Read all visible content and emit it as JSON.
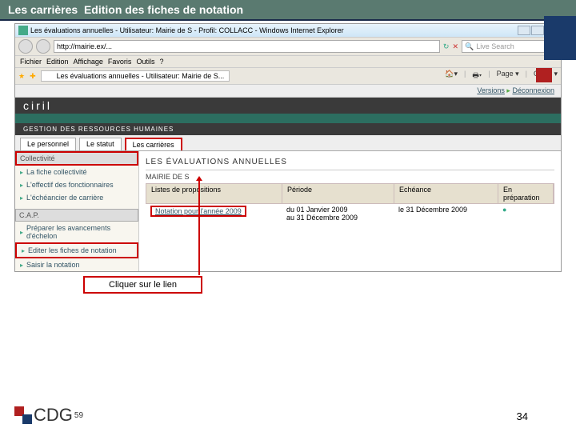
{
  "slide": {
    "title_a": "Les carrières",
    "title_b": "Edition des fiches de notation",
    "callout": "Cliquer sur le lien",
    "page_num": "34",
    "logo_text": "CDG",
    "logo_sup": "59"
  },
  "ie": {
    "window_title": "Les évaluations annuelles - Utilisateur: Mairie de S          - Profil: COLLACC - Windows Internet Explorer",
    "url": "http://mairie.ex/...",
    "search_ph": "Live Search",
    "toolbar_items": [
      "Fichier",
      "Edition",
      "Affichage",
      "Favoris",
      "Outils",
      "?"
    ],
    "tab_label": "Les évaluations annuelles - Utilisateur: Mairie de S...",
    "cmd_home": "▾",
    "cmd_print": "▾",
    "cmd_page": "Page ▾",
    "cmd_tools": "Outils ▾"
  },
  "app": {
    "top_right_a": "Versions",
    "top_right_b": "Déconnexion",
    "brand": "ciril",
    "band_label": "GESTION DES RESSOURCES HUMAINES",
    "tabs": [
      "Le personnel",
      "Le statut",
      "Les carrières"
    ],
    "panel1_head": "Collectivité",
    "panel1_items": [
      "La fiche collectivité",
      "L'effectif des fonctionnaires",
      "L'échéancier de carrière"
    ],
    "panel2_head": "C.A.P.",
    "panel2_items": [
      "Préparer les avancements d'échelon",
      "Editer les fiches de notation",
      "Saisir la notation"
    ],
    "main_title": "LES ÉVALUATIONS ANNUELLES",
    "sub_title": "MAIRIE DE S",
    "grid_headers": [
      "Listes de propositions",
      "Période",
      "Echéance",
      "En préparation"
    ],
    "row": {
      "link": "Notation pour l'année 2009",
      "periode": "du 01 Janvier 2009\nau 31 Décembre 2009",
      "echeance": "le 31 Décembre 2009",
      "prep": "●"
    }
  }
}
